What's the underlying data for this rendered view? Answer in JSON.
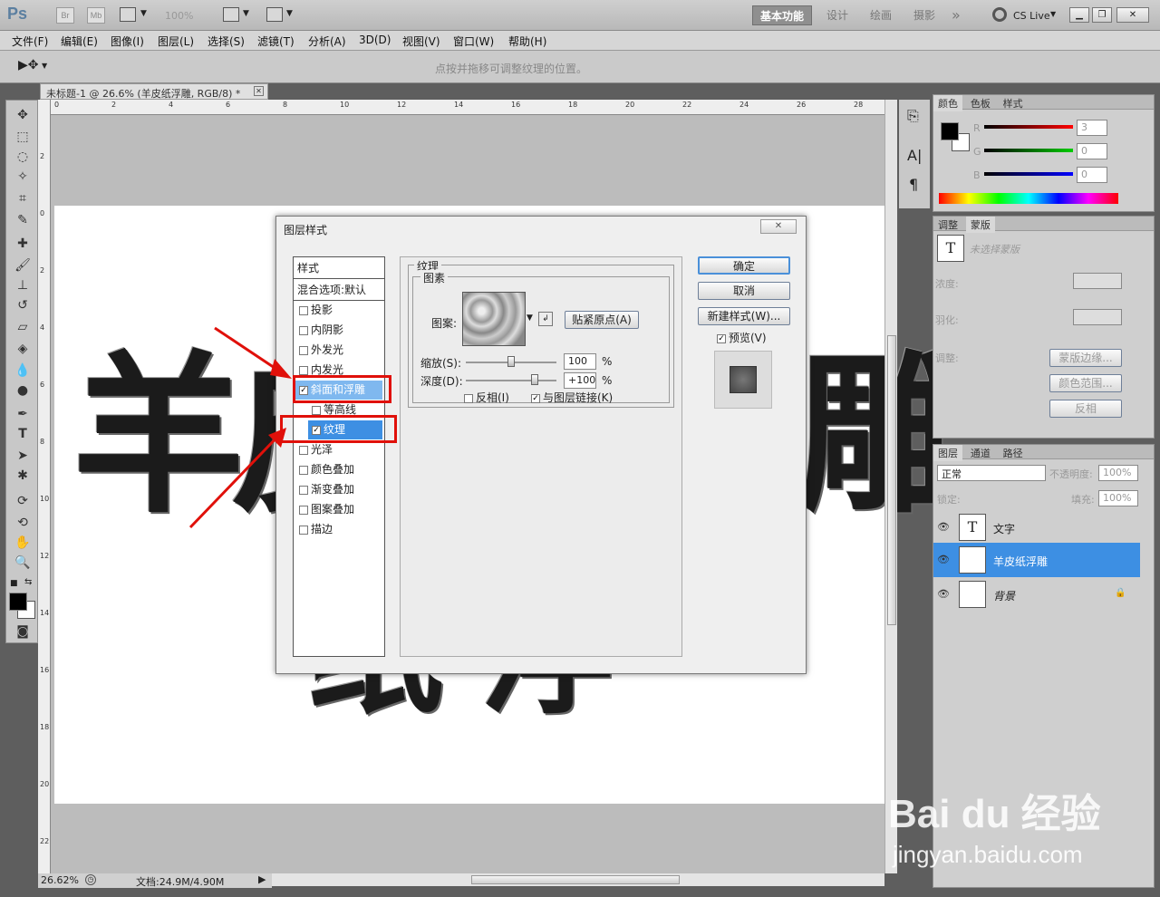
{
  "app": {
    "logo": "Ps",
    "mini_br": "Br",
    "mini_mb": "Mb",
    "zoom_display": "100%",
    "workspaces": [
      "基本功能",
      "设计",
      "绘画",
      "摄影"
    ],
    "more_workspaces": "»",
    "cslive": "CS Live"
  },
  "menu": [
    "文件(F)",
    "编辑(E)",
    "图像(I)",
    "图层(L)",
    "选择(S)",
    "滤镜(T)",
    "分析(A)",
    "3D(D)",
    "视图(V)",
    "窗口(W)",
    "帮助(H)"
  ],
  "options_hint": "点按并拖移可调整纹理的位置。",
  "document": {
    "tab_title": "未标题-1 @ 26.6% (羊皮纸浮雕, RGB/8) *",
    "ruler_h": [
      "0",
      "2",
      "4",
      "6",
      "8",
      "10",
      "12",
      "14",
      "16",
      "18",
      "20",
      "22",
      "24",
      "26",
      "28"
    ],
    "ruler_v": [
      "2",
      "0",
      "2",
      "4",
      "6",
      "8",
      "10",
      "12",
      "14",
      "16",
      "18",
      "20",
      "22"
    ],
    "canvas_chars": [
      "羊",
      "皮",
      "纸",
      "浮",
      "雕"
    ],
    "zoom": "26.62%",
    "doc_size": "文档:24.9M/4.90M"
  },
  "dialog": {
    "title": "图层样式",
    "style_header": "样式",
    "blend_options": "混合选项:默认",
    "styles": [
      {
        "label": "投影",
        "checked": false
      },
      {
        "label": "内阴影",
        "checked": false
      },
      {
        "label": "外发光",
        "checked": false
      },
      {
        "label": "内发光",
        "checked": false
      },
      {
        "label": "斜面和浮雕",
        "checked": true
      },
      {
        "label": "等高线",
        "checked": false
      },
      {
        "label": "纹理",
        "checked": true
      },
      {
        "label": "光泽",
        "checked": false
      },
      {
        "label": "颜色叠加",
        "checked": false
      },
      {
        "label": "渐变叠加",
        "checked": false
      },
      {
        "label": "图案叠加",
        "checked": false
      },
      {
        "label": "描边",
        "checked": false
      }
    ],
    "section_title": "纹理",
    "group_title": "图素",
    "pattern_label": "图案:",
    "snap_button": "贴紧原点(A)",
    "scale_label": "缩放(S):",
    "scale_value": "100",
    "depth_label": "深度(D):",
    "depth_value": "+100",
    "percent": "%",
    "invert_label": "反相(I)",
    "invert_checked": false,
    "link_label": "与图层链接(K)",
    "link_checked": true,
    "ok": "确定",
    "cancel": "取消",
    "new_style": "新建样式(W)...",
    "preview_label": "预览(V)",
    "preview_checked": true
  },
  "color_panel": {
    "tabs": [
      "颜色",
      "色板",
      "样式"
    ],
    "r_label": "R",
    "g_label": "G",
    "b_label": "B",
    "r": "3",
    "g": "0",
    "b": "0"
  },
  "mask_panel": {
    "tabs": [
      "调整",
      "蒙版"
    ],
    "no_selection": "未选择蒙版",
    "density": "浓度:",
    "feather": "羽化:",
    "adjust": "调整:",
    "mask_edge": "蒙版边缘...",
    "color_range": "颜色范围...",
    "invert": "反相"
  },
  "layers_panel": {
    "tabs": [
      "图层",
      "通道",
      "路径"
    ],
    "blend_mode": "正常",
    "opacity_label": "不透明度:",
    "opacity": "100%",
    "lock_label": "锁定:",
    "fill_label": "填充:",
    "fill": "100%",
    "layers": [
      {
        "name": "文字",
        "type": "text",
        "selected": false
      },
      {
        "name": "羊皮纸浮雕",
        "type": "text",
        "selected": true
      },
      {
        "name": "背景",
        "type": "bg",
        "selected": false
      }
    ]
  },
  "watermark": {
    "line1": "Bai du 经验",
    "line2": "jingyan.baidu.com"
  }
}
